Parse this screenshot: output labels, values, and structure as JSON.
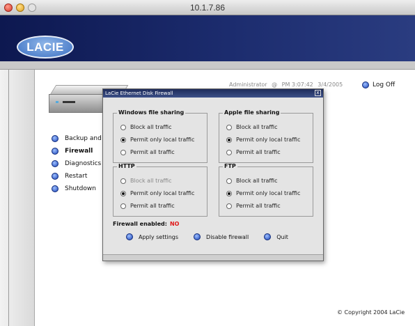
{
  "window": {
    "title": "10.1.7.86"
  },
  "brand": {
    "logo_text": "LACIE"
  },
  "status": {
    "user": "Administrator",
    "at": "@",
    "time": "PM 3:07:42",
    "date": "3/4/2005",
    "logoff_label": "Log Off"
  },
  "sidebar": {
    "items": [
      {
        "label": "Backup and I",
        "active": false
      },
      {
        "label": "Firewall",
        "active": true
      },
      {
        "label": "Diagnostics",
        "active": false
      },
      {
        "label": "Restart",
        "active": false
      },
      {
        "label": "Shutdown",
        "active": false
      }
    ]
  },
  "dialog": {
    "title": "LaCie Ethernet Disk Firewall",
    "close": "x",
    "groups": [
      {
        "name": "Windows file sharing",
        "options": [
          "Block all traffic",
          "Permit only local traffic",
          "Permit all traffic"
        ],
        "selected": 1
      },
      {
        "name": "Apple file sharing",
        "options": [
          "Block all traffic",
          "Permit only local traffic",
          "Permit all traffic"
        ],
        "selected": 1
      },
      {
        "name": "HTTP",
        "options": [
          "Block all traffic",
          "Permit only local traffic",
          "Permit all traffic"
        ],
        "selected": 1
      },
      {
        "name": "FTP",
        "options": [
          "Block all traffic",
          "Permit only local traffic",
          "Permit all traffic"
        ],
        "selected": 1
      }
    ],
    "firewall_label": "Firewall enabled:",
    "firewall_value": "NO",
    "buttons": {
      "apply": "Apply settings",
      "disable": "Disable firewall",
      "quit": "Quit"
    }
  },
  "footer": {
    "copyright": "© Copyright 2004 LaCie"
  },
  "colors": {
    "banner": "#1c2c6e",
    "accent_blue": "#1c45b8",
    "firewall_status": "#e01818"
  }
}
